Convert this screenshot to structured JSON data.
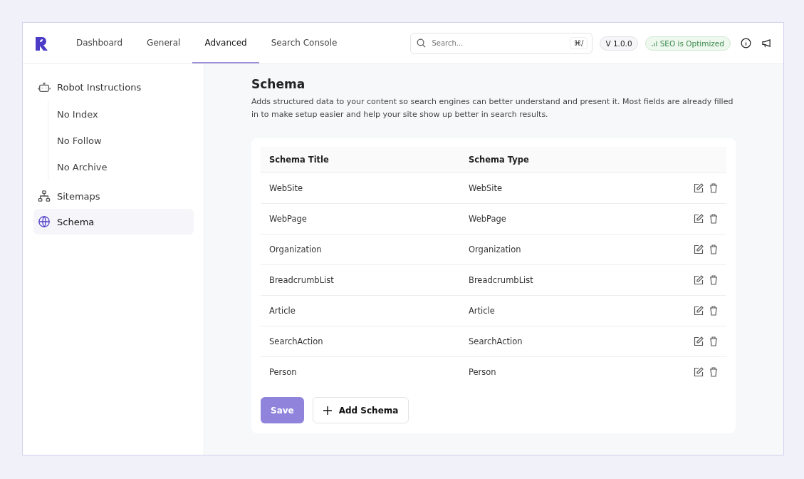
{
  "nav": {
    "tabs": [
      {
        "label": "Dashboard",
        "selected": false
      },
      {
        "label": "General",
        "selected": false
      },
      {
        "label": "Advanced",
        "selected": true
      },
      {
        "label": "Search Console",
        "selected": false
      }
    ],
    "search": {
      "placeholder": "Search...",
      "shortcut": "⌘/"
    },
    "version": "V 1.0.0",
    "status": "SEO is Optimized"
  },
  "sidebar": {
    "items": [
      {
        "label": "Robot Instructions",
        "selected": false,
        "children": [
          {
            "label": "No Index",
            "selected": false
          },
          {
            "label": "No Follow",
            "selected": false
          },
          {
            "label": "No Archive",
            "selected": false
          }
        ]
      },
      {
        "label": "Sitemaps",
        "selected": false
      },
      {
        "label": "Schema",
        "selected": true
      }
    ]
  },
  "content": {
    "title": "Schema",
    "description": "Adds structured data to your content so search engines can better understand and present it. Most fields are already filled in to make setup easier and help your site show up better in search results.",
    "table": {
      "columns": [
        "Schema Title",
        "Schema Type"
      ],
      "rows": [
        [
          "WebSite",
          "WebSite"
        ],
        [
          "WebPage",
          "WebPage"
        ],
        [
          "Organization",
          "Organization"
        ],
        [
          "BreadcrumbList",
          "BreadcrumbList"
        ],
        [
          "Article",
          "Article"
        ],
        [
          "SearchAction",
          "SearchAction"
        ],
        [
          "Person",
          "Person"
        ]
      ]
    },
    "save": {
      "label": "Save",
      "disabled": true
    },
    "add": {
      "label": "Add Schema"
    }
  }
}
